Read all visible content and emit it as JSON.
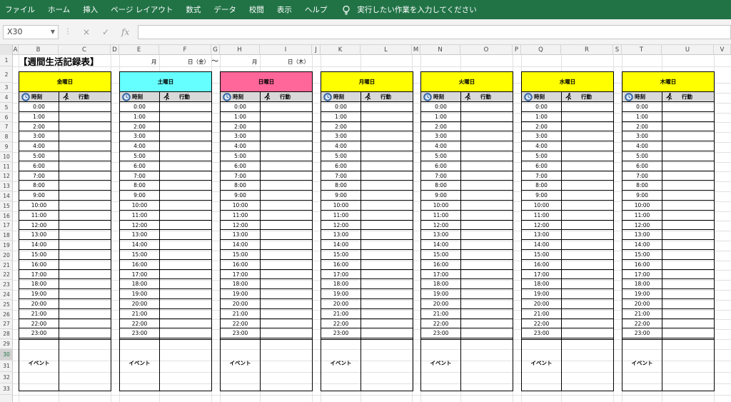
{
  "ribbon": {
    "tabs": [
      "ファイル",
      "ホーム",
      "挿入",
      "ページ レイアウト",
      "数式",
      "データ",
      "校閲",
      "表示",
      "ヘルプ"
    ],
    "tell_me": "実行したい作業を入力してください"
  },
  "formula_bar": {
    "name_box": "X30",
    "cancel_icon": "×",
    "enter_icon": "✓",
    "fx_icon": "fx",
    "value": ""
  },
  "columns": [
    "A",
    "B",
    "C",
    "D",
    "E",
    "F",
    "G",
    "H",
    "I",
    "J",
    "K",
    "L",
    "M",
    "N",
    "O",
    "P",
    "Q",
    "R",
    "S",
    "T",
    "U",
    "V"
  ],
  "rows": [
    "1",
    "2",
    "3",
    "4",
    "5",
    "6",
    "7",
    "8",
    "9",
    "10",
    "11",
    "12",
    "13",
    "14",
    "15",
    "16",
    "17",
    "18",
    "19",
    "20",
    "21",
    "22",
    "23",
    "24",
    "25",
    "26",
    "27",
    "28",
    "29",
    "30",
    "31",
    "32",
    "33"
  ],
  "selected_row": "30",
  "sheet": {
    "title": "【週間生活記録表】",
    "header_month": "月",
    "header_day_from": "日（金）",
    "tilde": "～",
    "header_month2": "月",
    "header_day_to": "日（木）",
    "time_label": "時刻",
    "action_label": "行動",
    "event_label": "イベント",
    "times": [
      "0:00",
      "1:00",
      "2:00",
      "3:00",
      "4:00",
      "5:00",
      "6:00",
      "7:00",
      "8:00",
      "9:00",
      "10:00",
      "11:00",
      "12:00",
      "13:00",
      "14:00",
      "15:00",
      "16:00",
      "17:00",
      "18:00",
      "19:00",
      "20:00",
      "21:00",
      "22:00",
      "23:00"
    ],
    "days": [
      {
        "name": "金曜日",
        "color": "#ffff00"
      },
      {
        "name": "土曜日",
        "color": "#66ffff"
      },
      {
        "name": "日曜日",
        "color": "#ff6699"
      },
      {
        "name": "月曜日",
        "color": "#ffff00"
      },
      {
        "name": "火曜日",
        "color": "#ffff00"
      },
      {
        "name": "水曜日",
        "color": "#ffff00"
      },
      {
        "name": "木曜日",
        "color": "#ffff00"
      }
    ]
  },
  "icons": {
    "clock": "clock-icon",
    "runner": "runner-icon",
    "bulb": "lightbulb-icon",
    "dropdown": "chevron-down-icon"
  },
  "colors": {
    "ribbon": "#217346",
    "subheader": "#d9d9d9"
  }
}
